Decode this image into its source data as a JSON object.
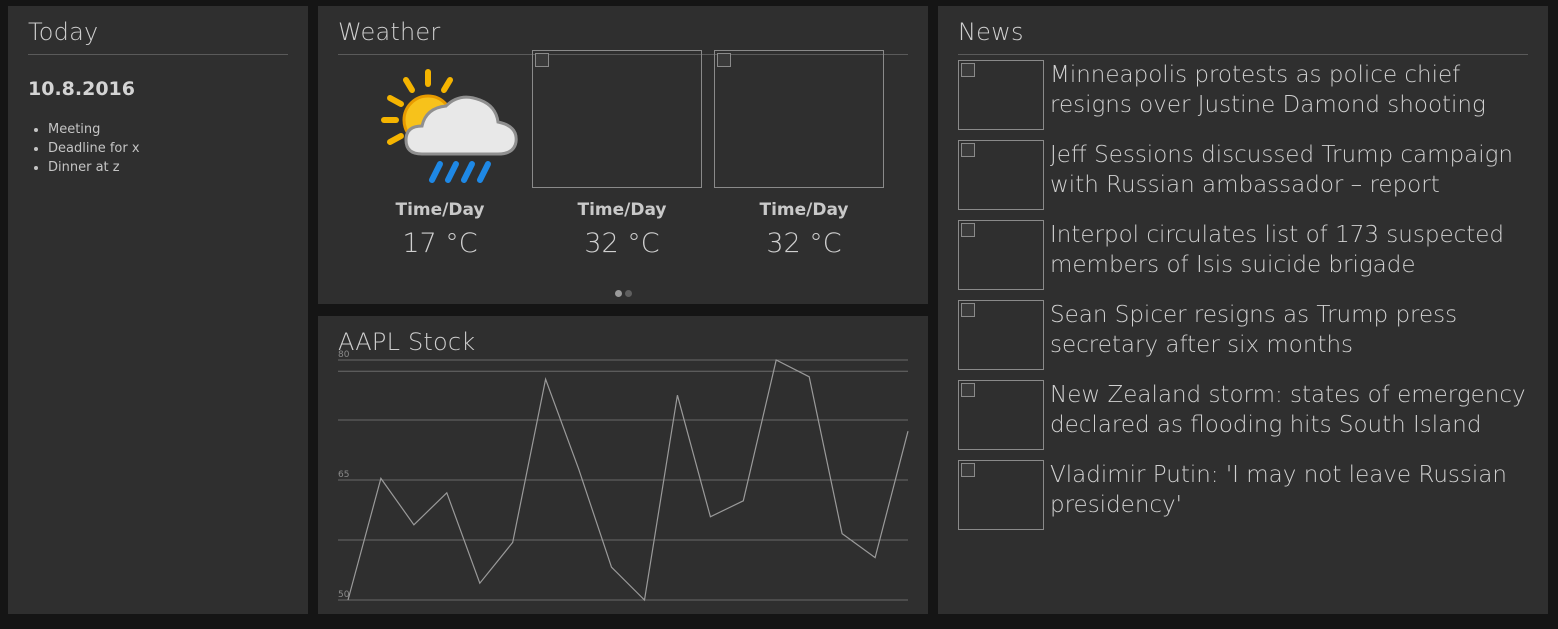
{
  "today": {
    "title": "Today",
    "date": "10.8.2016",
    "items": [
      "Meeting",
      "Deadline for x",
      "Dinner at z"
    ]
  },
  "weather": {
    "title": "Weather",
    "forecasts": [
      {
        "label": "Time/Day",
        "temp": "17 °C",
        "icon": "partly-cloudy-rain-icon"
      },
      {
        "label": "Time/Day",
        "temp": "32 °C",
        "icon": "broken-image-icon"
      },
      {
        "label": "Time/Day",
        "temp": "32 °C",
        "icon": "broken-image-icon"
      }
    ],
    "pager": {
      "pages": 2,
      "active": 1
    }
  },
  "stock": {
    "title": "AAPL Stock"
  },
  "chart_data": {
    "type": "line",
    "title": "AAPL Stock",
    "ylim": [
      50,
      80
    ],
    "y_ticks": [
      "80",
      "65",
      "50"
    ],
    "grid": true,
    "series": [
      {
        "values": [
          50,
          65.2,
          59.4,
          63.4,
          52.1,
          57.2,
          77.6,
          66.4,
          54.1,
          50.0,
          75.6,
          60.4,
          62.4,
          80.0,
          77.9,
          58.3,
          55.3,
          71.1
        ]
      }
    ]
  },
  "news": {
    "title": "News",
    "items": [
      {
        "headline": "Minneapolis protests as police chief resigns over Justine Damond shooting"
      },
      {
        "headline": "Jeff Sessions discussed Trump campaign with Russian ambassador – report"
      },
      {
        "headline": "Interpol circulates list of 173 suspected members of Isis suicide brigade"
      },
      {
        "headline": "Sean Spicer resigns as Trump press secretary after six months"
      },
      {
        "headline": "New Zealand storm: states of emergency declared as flooding hits South Island"
      },
      {
        "headline": "Vladimir Putin: 'I may not leave Russian presidency'"
      }
    ]
  }
}
